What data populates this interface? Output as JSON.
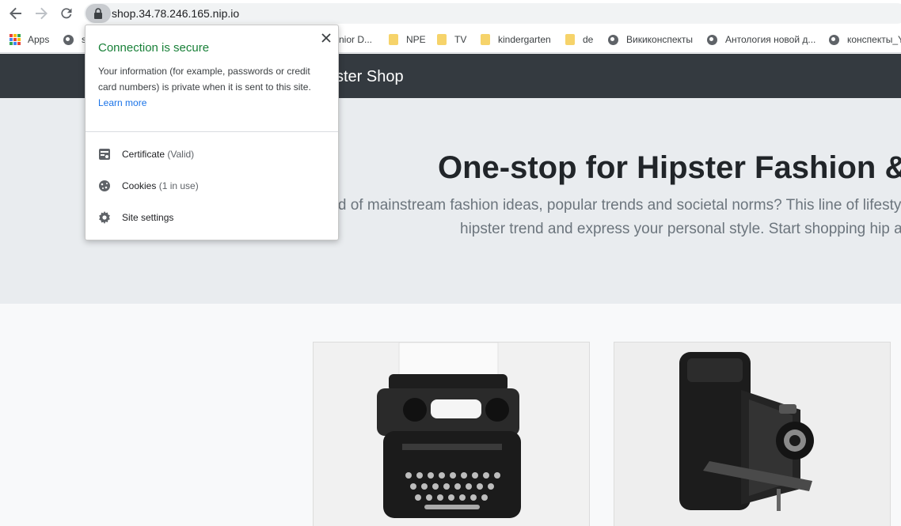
{
  "browser": {
    "url": "shop.34.78.246.165.nip.io",
    "bookmarks": [
      {
        "label": "Apps",
        "icon": "apps-grid-icon"
      },
      {
        "label": "s",
        "icon": "globe-icon"
      },
      {
        "label": "nior D...",
        "icon": "none"
      },
      {
        "label": "NPE",
        "icon": "folder-icon"
      },
      {
        "label": "TV",
        "icon": "folder-icon"
      },
      {
        "label": "kindergarten",
        "icon": "folder-icon"
      },
      {
        "label": "de",
        "icon": "folder-icon"
      },
      {
        "label": "Викиконспекты",
        "icon": "globe-icon"
      },
      {
        "label": "Антология новой д...",
        "icon": "globe-icon"
      },
      {
        "label": "конспекты_Y",
        "icon": "globe-icon"
      }
    ]
  },
  "site": {
    "name": "ster Shop",
    "hero_title": "One-stop for Hipster Fashion & S",
    "hero_line1": "red of mainstream fashion ideas, popular trends and societal norms? This line of lifesty",
    "hero_line2": "hipster trend and express your personal style. Start shopping hip ar"
  },
  "products": [
    {
      "name": "typewriter",
      "image": "typewriter-image"
    },
    {
      "name": "camera",
      "image": "camera-image"
    }
  ],
  "popup": {
    "title": "Connection is secure",
    "body": "Your information (for example, passwords or credit card numbers) is private when it is sent to this site.",
    "learn_more": "Learn more",
    "certificate_label": "Certificate",
    "certificate_status": "(Valid)",
    "cookies_label": "Cookies",
    "cookies_status": "(1 in use)",
    "site_settings_label": "Site settings"
  },
  "colors": {
    "header": "#343a40",
    "hero": "#e9ecef",
    "secure_green": "#188038",
    "link_blue": "#1a73e8"
  }
}
